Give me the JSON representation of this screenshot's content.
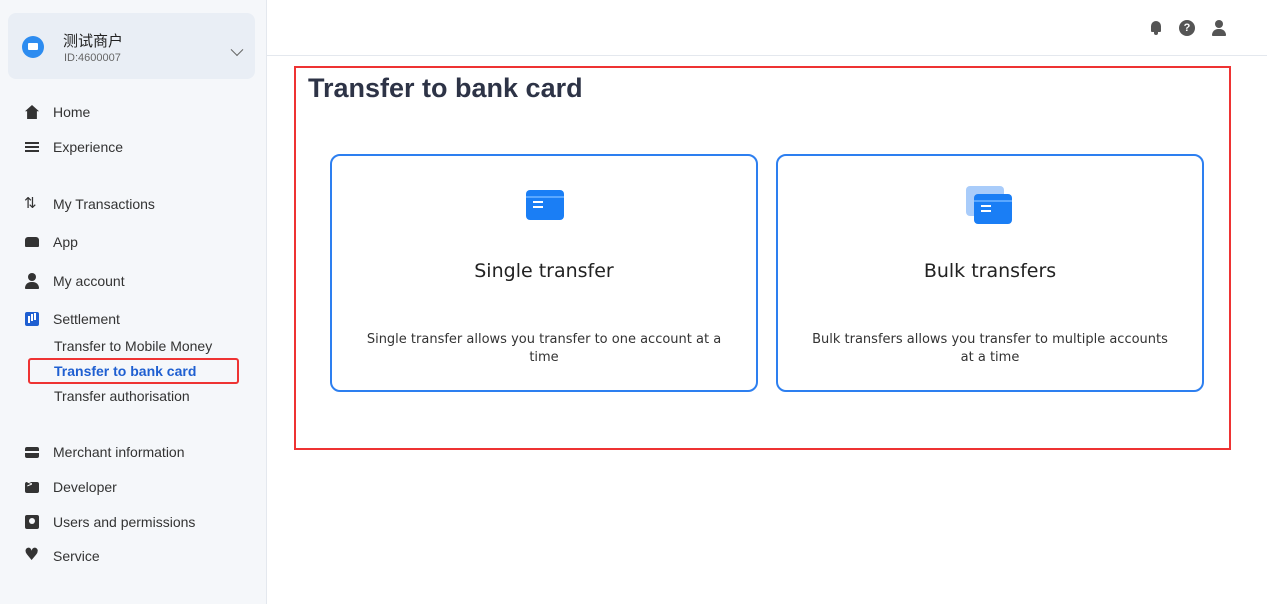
{
  "merchant": {
    "name": "测试商户",
    "id": "ID:4600007"
  },
  "nav": {
    "home": "Home",
    "experience": "Experience",
    "transactions": "My Transactions",
    "app": "App",
    "account": "My account",
    "settlement": "Settlement",
    "settlement_sub": [
      "Transfer to Mobile Money",
      "Transfer to bank card",
      "Transfer authorisation"
    ],
    "merchant_info": "Merchant information",
    "developer": "Developer",
    "users": "Users and permissions",
    "service": "Service"
  },
  "header": {
    "help_glyph": "?"
  },
  "main": {
    "title": "Transfer to bank card",
    "cards": [
      {
        "title": "Single transfer",
        "description": "Single transfer allows you transfer to one account at a time"
      },
      {
        "title": "Bulk transfers",
        "description": "Bulk transfers allows you transfer to multiple accounts at a time"
      }
    ]
  },
  "colors": {
    "accent": "#1f5fd1",
    "card_border": "#2d7ff0",
    "highlight": "#e33333"
  }
}
